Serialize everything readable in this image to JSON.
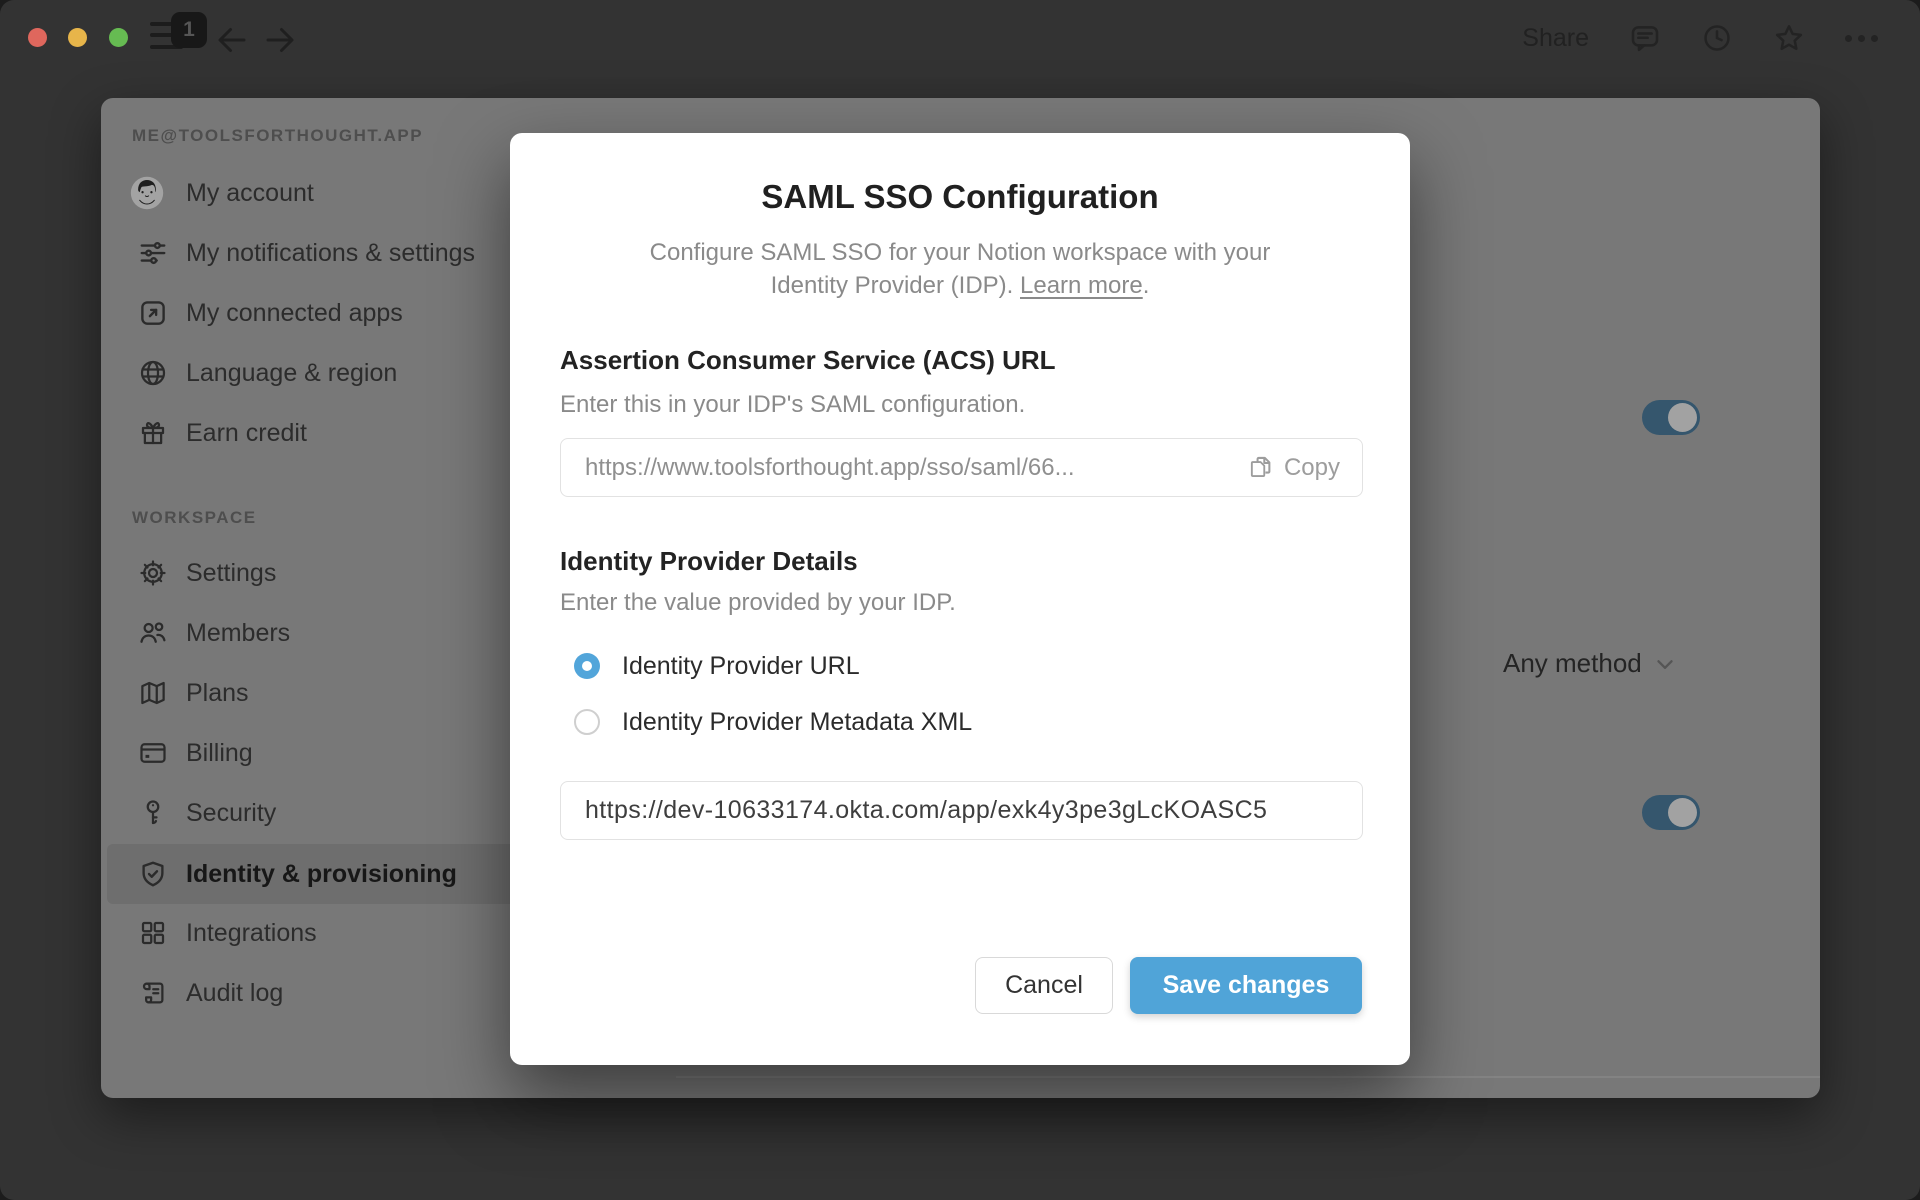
{
  "titlebar": {
    "badge_count": "1",
    "share_label": "Share"
  },
  "sidebar": {
    "account_header": "ME@TOOLSFORTHOUGHT.APP",
    "account_items": [
      {
        "label": "My account",
        "icon": "user-avatar"
      },
      {
        "label": "My notifications & settings",
        "icon": "sliders-icon"
      },
      {
        "label": "My connected apps",
        "icon": "arrow-up-right-square-icon"
      },
      {
        "label": "Language & region",
        "icon": "globe-icon"
      },
      {
        "label": "Earn credit",
        "icon": "gift-icon"
      }
    ],
    "workspace_header": "WORKSPACE",
    "workspace_items": [
      {
        "label": "Settings",
        "icon": "gear-icon"
      },
      {
        "label": "Members",
        "icon": "people-icon"
      },
      {
        "label": "Plans",
        "icon": "map-icon"
      },
      {
        "label": "Billing",
        "icon": "credit-card-icon"
      },
      {
        "label": "Security",
        "icon": "key-icon"
      },
      {
        "label": "Identity & provisioning",
        "icon": "shield-check-icon",
        "active": true
      },
      {
        "label": "Integrations",
        "icon": "grid-icon"
      },
      {
        "label": "Audit log",
        "icon": "scroll-icon"
      }
    ]
  },
  "content": {
    "auth_method_value": "Any method",
    "sso_toggle_on": true,
    "scim_toggle_on": true
  },
  "modal": {
    "title": "SAML SSO Configuration",
    "description_line1": "Configure SAML SSO for your Notion workspace with your",
    "description_line2_prefix": "Identity Provider (IDP). ",
    "learn_more_label": "Learn more",
    "learn_more_suffix": ".",
    "acs": {
      "heading": "Assertion Consumer Service (ACS) URL",
      "hint": "Enter this in your IDP's SAML configuration.",
      "value": "https://www.toolsforthought.app/sso/saml/66...",
      "copy_label": "Copy"
    },
    "idp": {
      "heading": "Identity Provider Details",
      "hint": "Enter the value provided by your IDP.",
      "options": [
        {
          "label": "Identity Provider URL",
          "selected": true
        },
        {
          "label": "Identity Provider Metadata XML",
          "selected": false
        }
      ],
      "url_value": "https://dev-10633174.okta.com/app/exk4y3pe3gLcKOASC5"
    },
    "cancel_label": "Cancel",
    "save_label": "Save changes"
  },
  "colors": {
    "accent_blue": "#50a4d8",
    "dimmed_toggle_blue": "#35566d",
    "traffic_red": "#df675d",
    "traffic_yellow": "#e7b54a",
    "traffic_green": "#66bb52"
  }
}
